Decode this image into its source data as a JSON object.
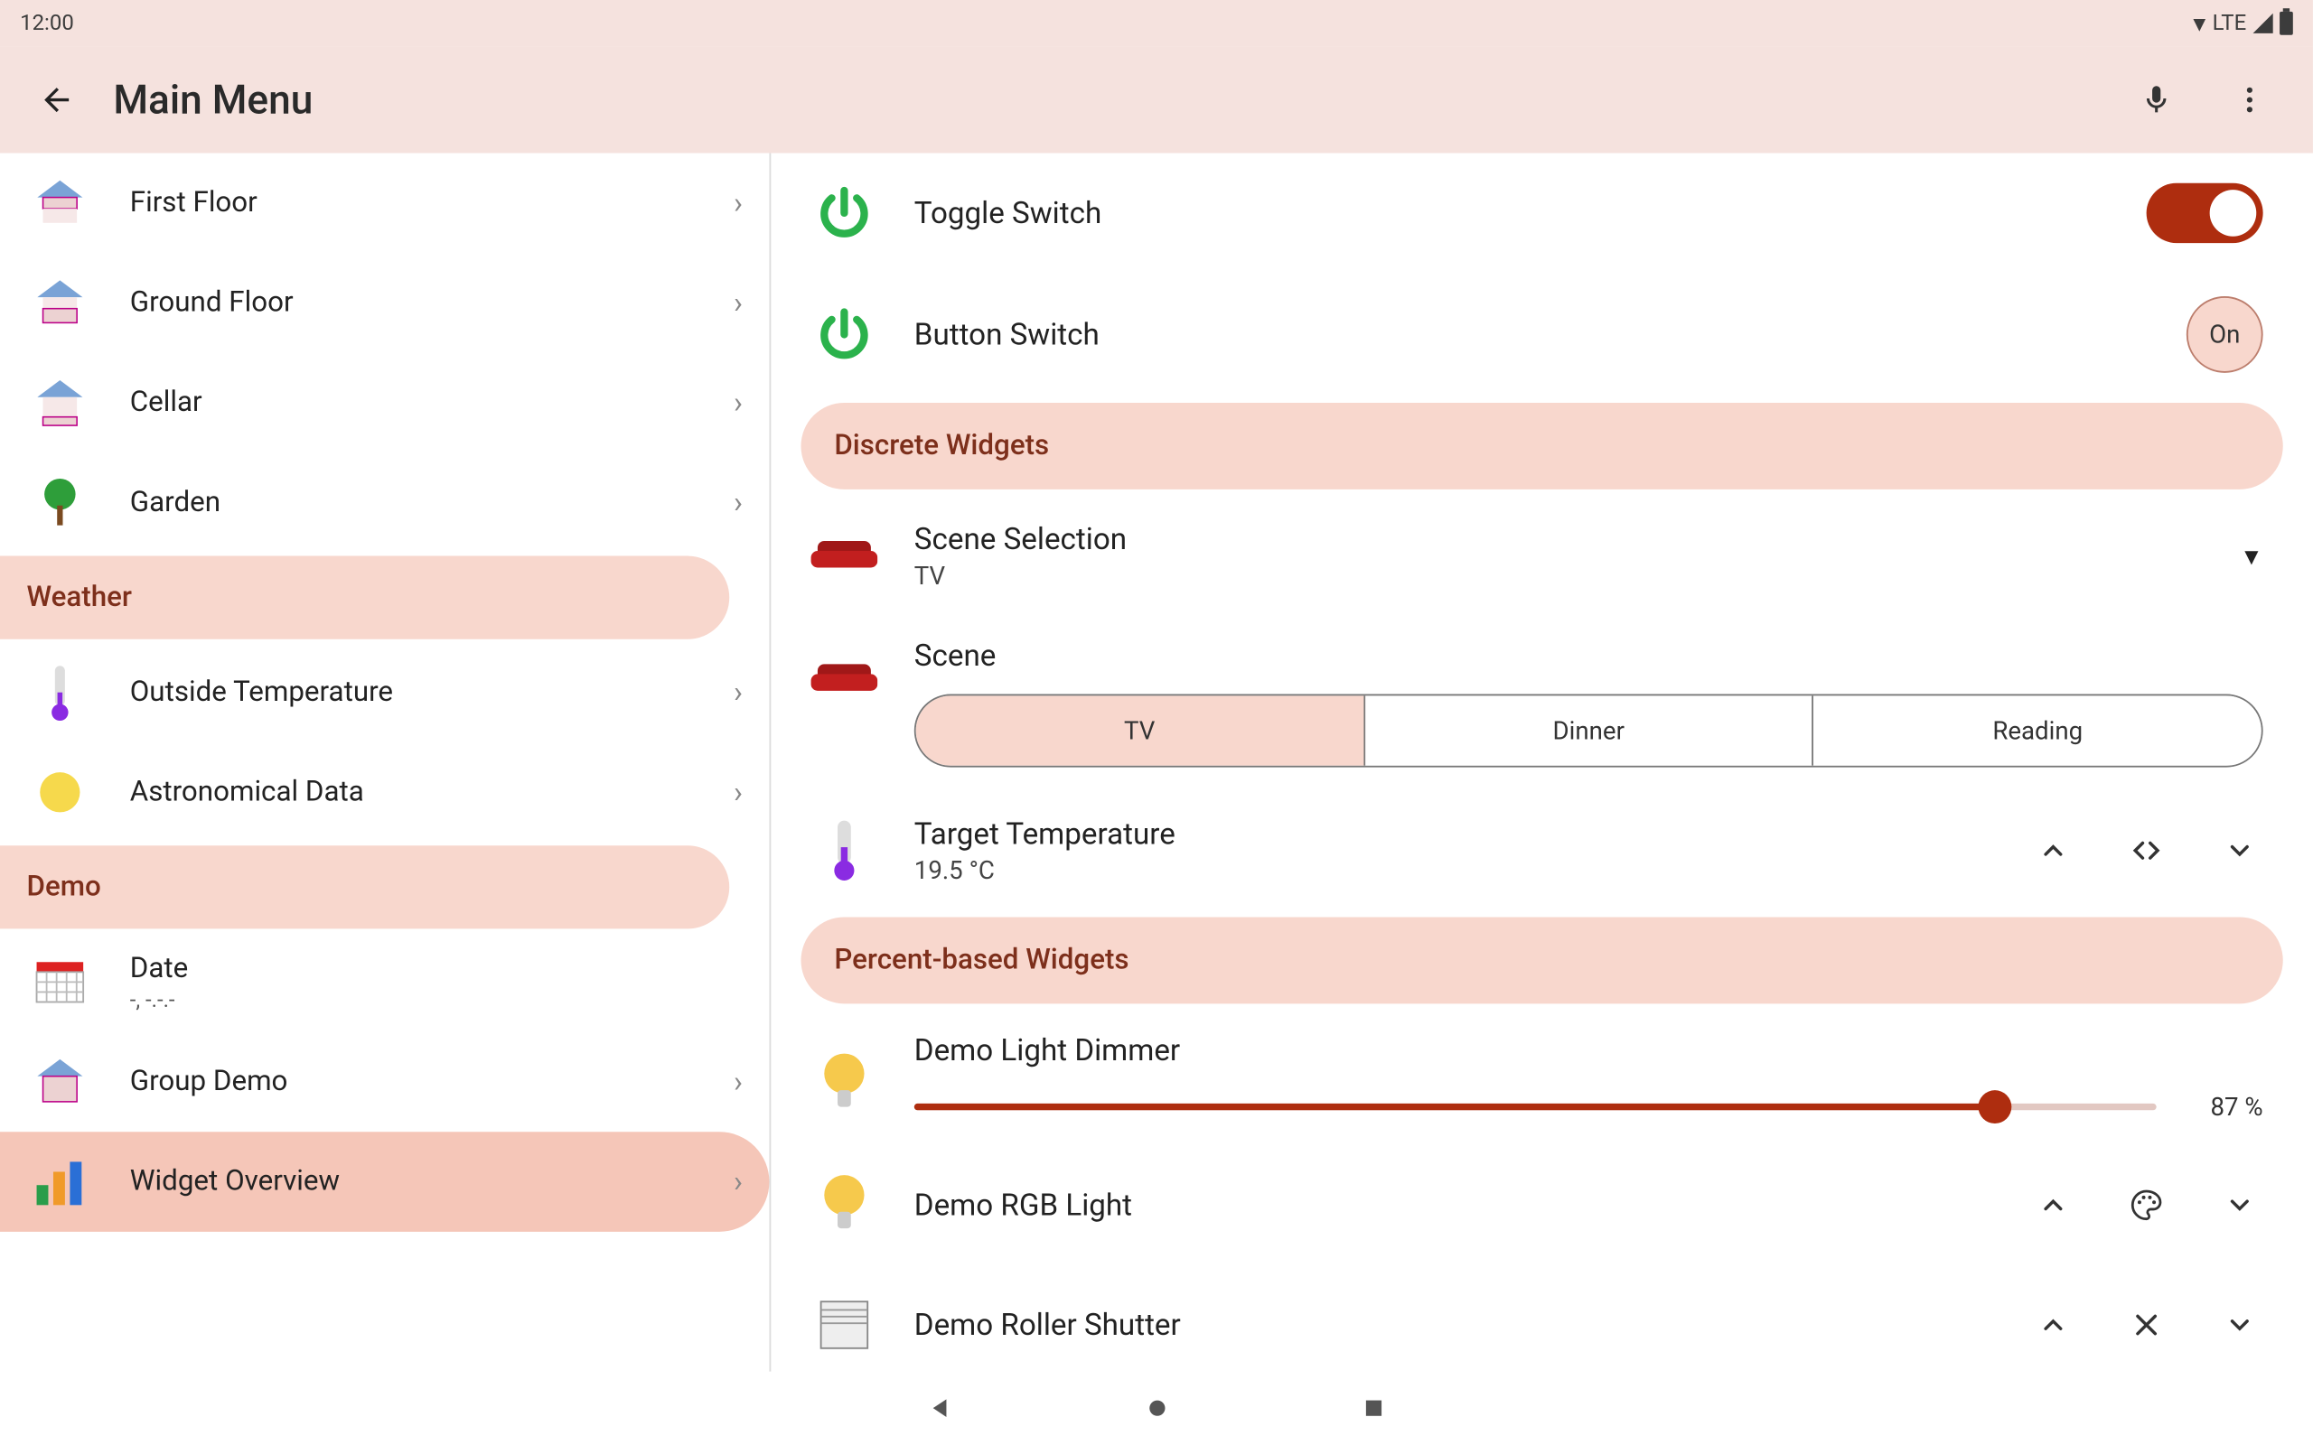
{
  "statusbar": {
    "time": "12:00",
    "network": "LTE"
  },
  "appbar": {
    "title": "Main Menu"
  },
  "sidebar": {
    "sections": [
      {
        "items": [
          {
            "id": "first-floor",
            "label": "First Floor"
          },
          {
            "id": "ground-floor",
            "label": "Ground Floor"
          },
          {
            "id": "cellar",
            "label": "Cellar"
          },
          {
            "id": "garden",
            "label": "Garden"
          }
        ]
      },
      {
        "title": "Weather",
        "items": [
          {
            "id": "outside-temp",
            "label": "Outside Temperature"
          },
          {
            "id": "astronomical",
            "label": "Astronomical Data"
          }
        ]
      },
      {
        "title": "Demo",
        "items": [
          {
            "id": "date",
            "label": "Date",
            "sublabel": "-, -.-.-"
          },
          {
            "id": "group-demo",
            "label": "Group Demo"
          },
          {
            "id": "widget-overview",
            "label": "Widget Overview",
            "selected": true
          }
        ]
      }
    ]
  },
  "content": {
    "toggle_switch": {
      "label": "Toggle Switch",
      "state": true
    },
    "button_switch": {
      "label": "Button Switch",
      "button": "On"
    },
    "section_discrete": "Discrete Widgets",
    "scene_selection": {
      "label": "Scene Selection",
      "value": "TV"
    },
    "scene": {
      "label": "Scene",
      "options": [
        "TV",
        "Dinner",
        "Reading"
      ],
      "selected": "TV"
    },
    "target_temp": {
      "label": "Target Temperature",
      "value": "19.5 °C"
    },
    "section_percent": "Percent-based Widgets",
    "dimmer": {
      "label": "Demo Light Dimmer",
      "percent": 87,
      "display": "87 %"
    },
    "rgb_light": {
      "label": "Demo RGB Light"
    },
    "roller_shutter": {
      "label": "Demo Roller Shutter"
    }
  }
}
